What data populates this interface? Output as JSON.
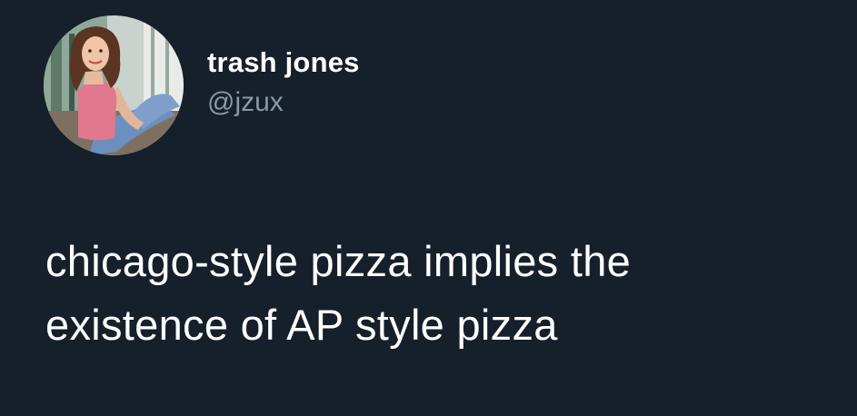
{
  "author": {
    "display_name": "trash jones",
    "handle": "@jzux",
    "avatar_icon": "profile-photo"
  },
  "tweet": {
    "lines": [
      "chicago-style pizza implies the",
      "existence of AP style pizza"
    ]
  },
  "colors": {
    "background": "#15202b",
    "text": "#ffffff",
    "secondary_text": "#8b98a5"
  }
}
